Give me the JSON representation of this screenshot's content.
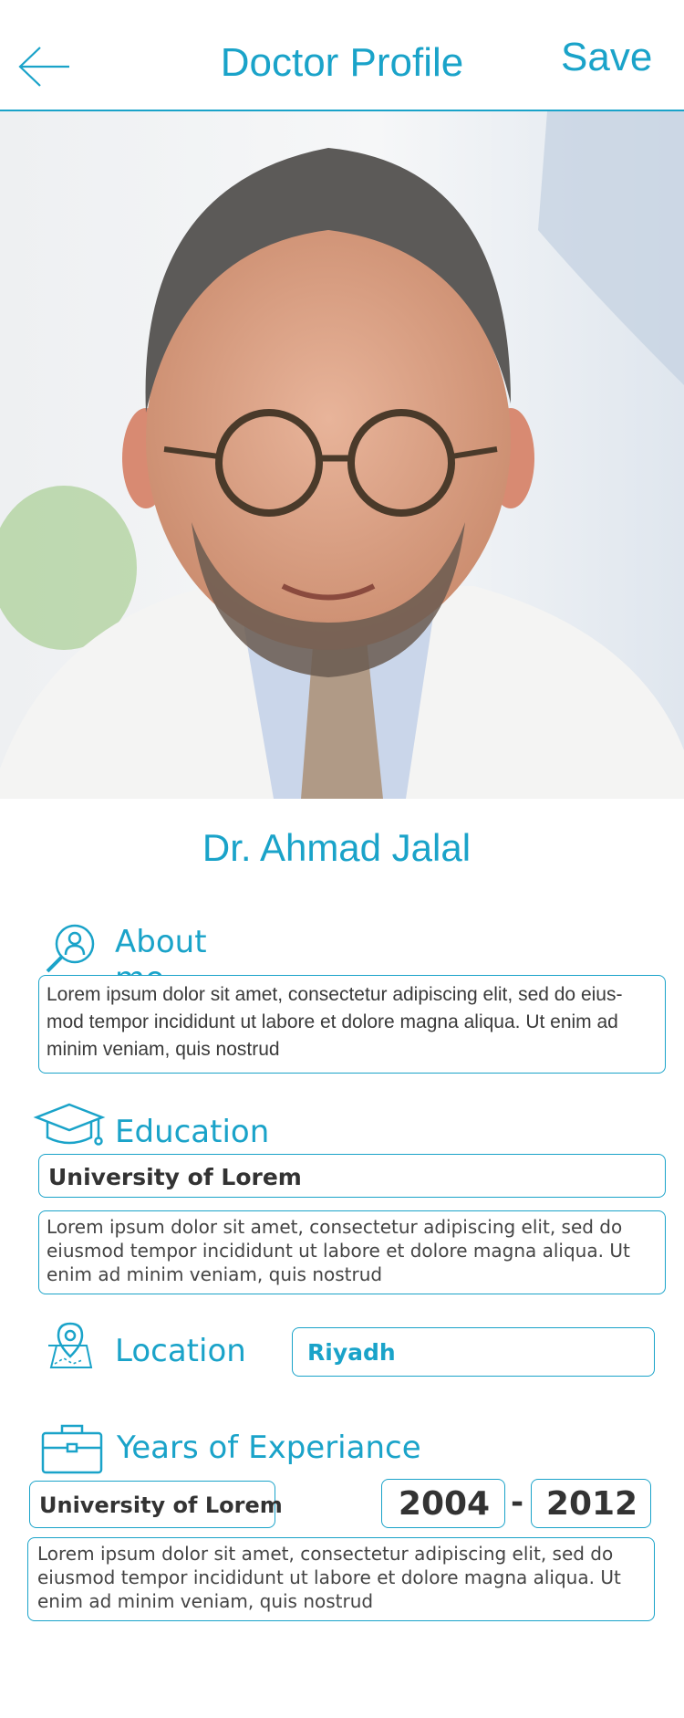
{
  "header": {
    "title": "Doctor Profile",
    "save_label": "Save"
  },
  "doctor": {
    "name": "Dr. Ahmad Jalal"
  },
  "about": {
    "title": "About me",
    "text": "Lorem ipsum dolor sit amet, consectetur adipiscing elit, sed do eius- mod tempor incididunt ut labore et dolore magna aliqua. Ut enim ad minim veniam, quis nostrud"
  },
  "education": {
    "title": "Education",
    "school": "University of Lorem",
    "text": "Lorem ipsum dolor sit amet, consectetur adipiscing elit, sed do eiusmod tempor incididunt ut labore et dolore magna aliqua. Ut enim ad minim veniam, quis nostrud"
  },
  "location": {
    "title": "Location",
    "value": "Riyadh"
  },
  "experience": {
    "title": "Years of Experiance",
    "place": "University of Lorem",
    "from": "2004",
    "separator": "-",
    "to": "2012",
    "text": "Lorem ipsum dolor sit amet, consectetur adipiscing elit, sed do eiusmod tempor incididunt ut labore et dolore magna aliqua. Ut enim ad minim veniam, quis nostrud"
  },
  "icons": {
    "back": "arrow-left-icon",
    "about": "profile-search-icon",
    "education": "graduation-cap-icon",
    "location": "map-pin-icon",
    "experience": "briefcase-icon"
  },
  "colors": {
    "accent": "#1aa3c9",
    "text": "#333333",
    "background": "#ffffff"
  }
}
